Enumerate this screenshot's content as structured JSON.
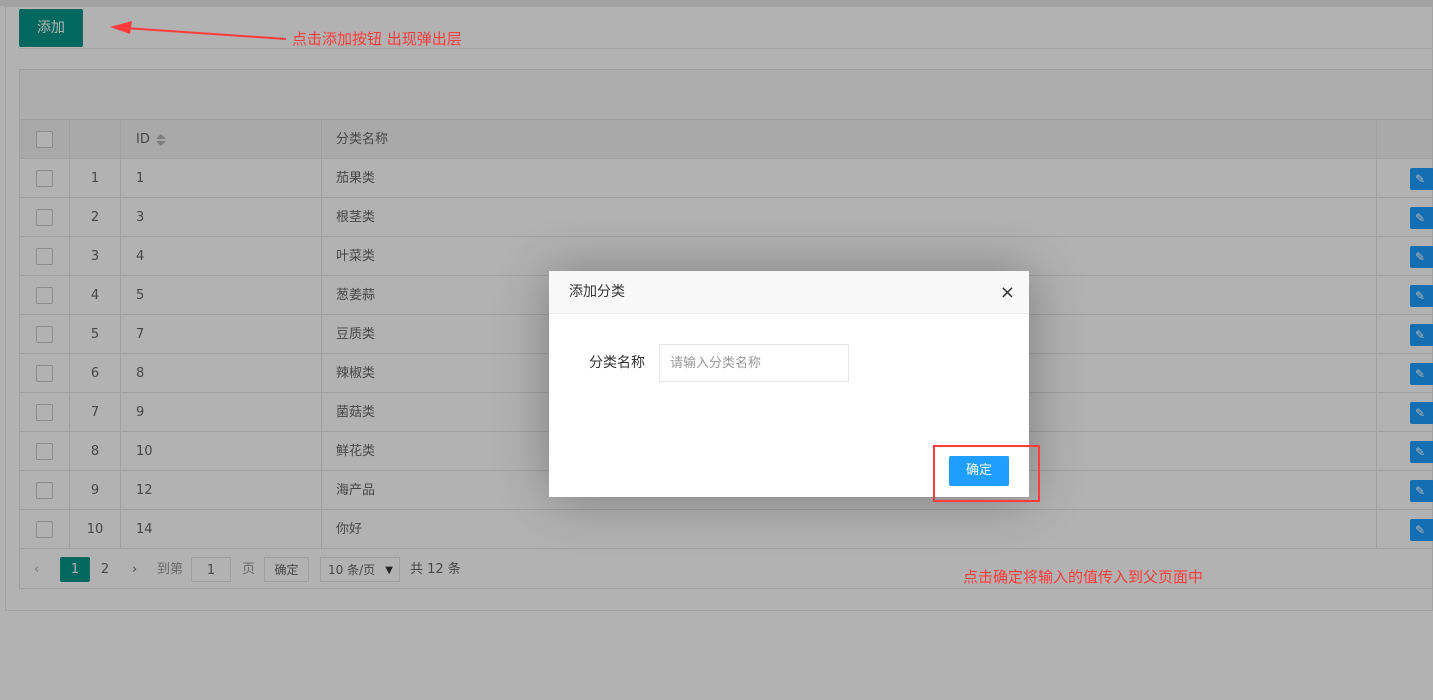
{
  "toolbar": {
    "add_label": "添加"
  },
  "table": {
    "headers": {
      "id": "ID",
      "name": "分类名称"
    },
    "rows": [
      {
        "index": "1",
        "id": "1",
        "name": "茄果类"
      },
      {
        "index": "2",
        "id": "3",
        "name": "根茎类"
      },
      {
        "index": "3",
        "id": "4",
        "name": "叶菜类"
      },
      {
        "index": "4",
        "id": "5",
        "name": "葱姜蒜"
      },
      {
        "index": "5",
        "id": "7",
        "name": "豆质类"
      },
      {
        "index": "6",
        "id": "8",
        "name": "辣椒类"
      },
      {
        "index": "7",
        "id": "9",
        "name": "菌菇类"
      },
      {
        "index": "8",
        "id": "10",
        "name": "鲜花类"
      },
      {
        "index": "9",
        "id": "12",
        "name": "海产品"
      },
      {
        "index": "10",
        "id": "14",
        "name": "你好"
      }
    ],
    "row_action_icon": "pencil-icon"
  },
  "pager": {
    "prev_icon": "‹",
    "page_1": "1",
    "page_2": "2",
    "next_icon": "›",
    "goto_label": "到第",
    "goto_value": "1",
    "page_unit": "页",
    "confirm_label": "确定",
    "page_size": "10 条/页",
    "total": "共 12 条"
  },
  "modal": {
    "title": "添加分类",
    "close_icon": "×",
    "field_label": "分类名称",
    "field_placeholder": "请输入分类名称",
    "field_value": "",
    "ok_label": "确定"
  },
  "annotations": {
    "add_note": "点击添加按钮  出现弹出层",
    "confirm_note": "点击确定将输入的值传入到父页面中",
    "color": "#ff3b3b"
  },
  "colors": {
    "primary_green": "#009688",
    "primary_blue": "#1e9fff"
  }
}
